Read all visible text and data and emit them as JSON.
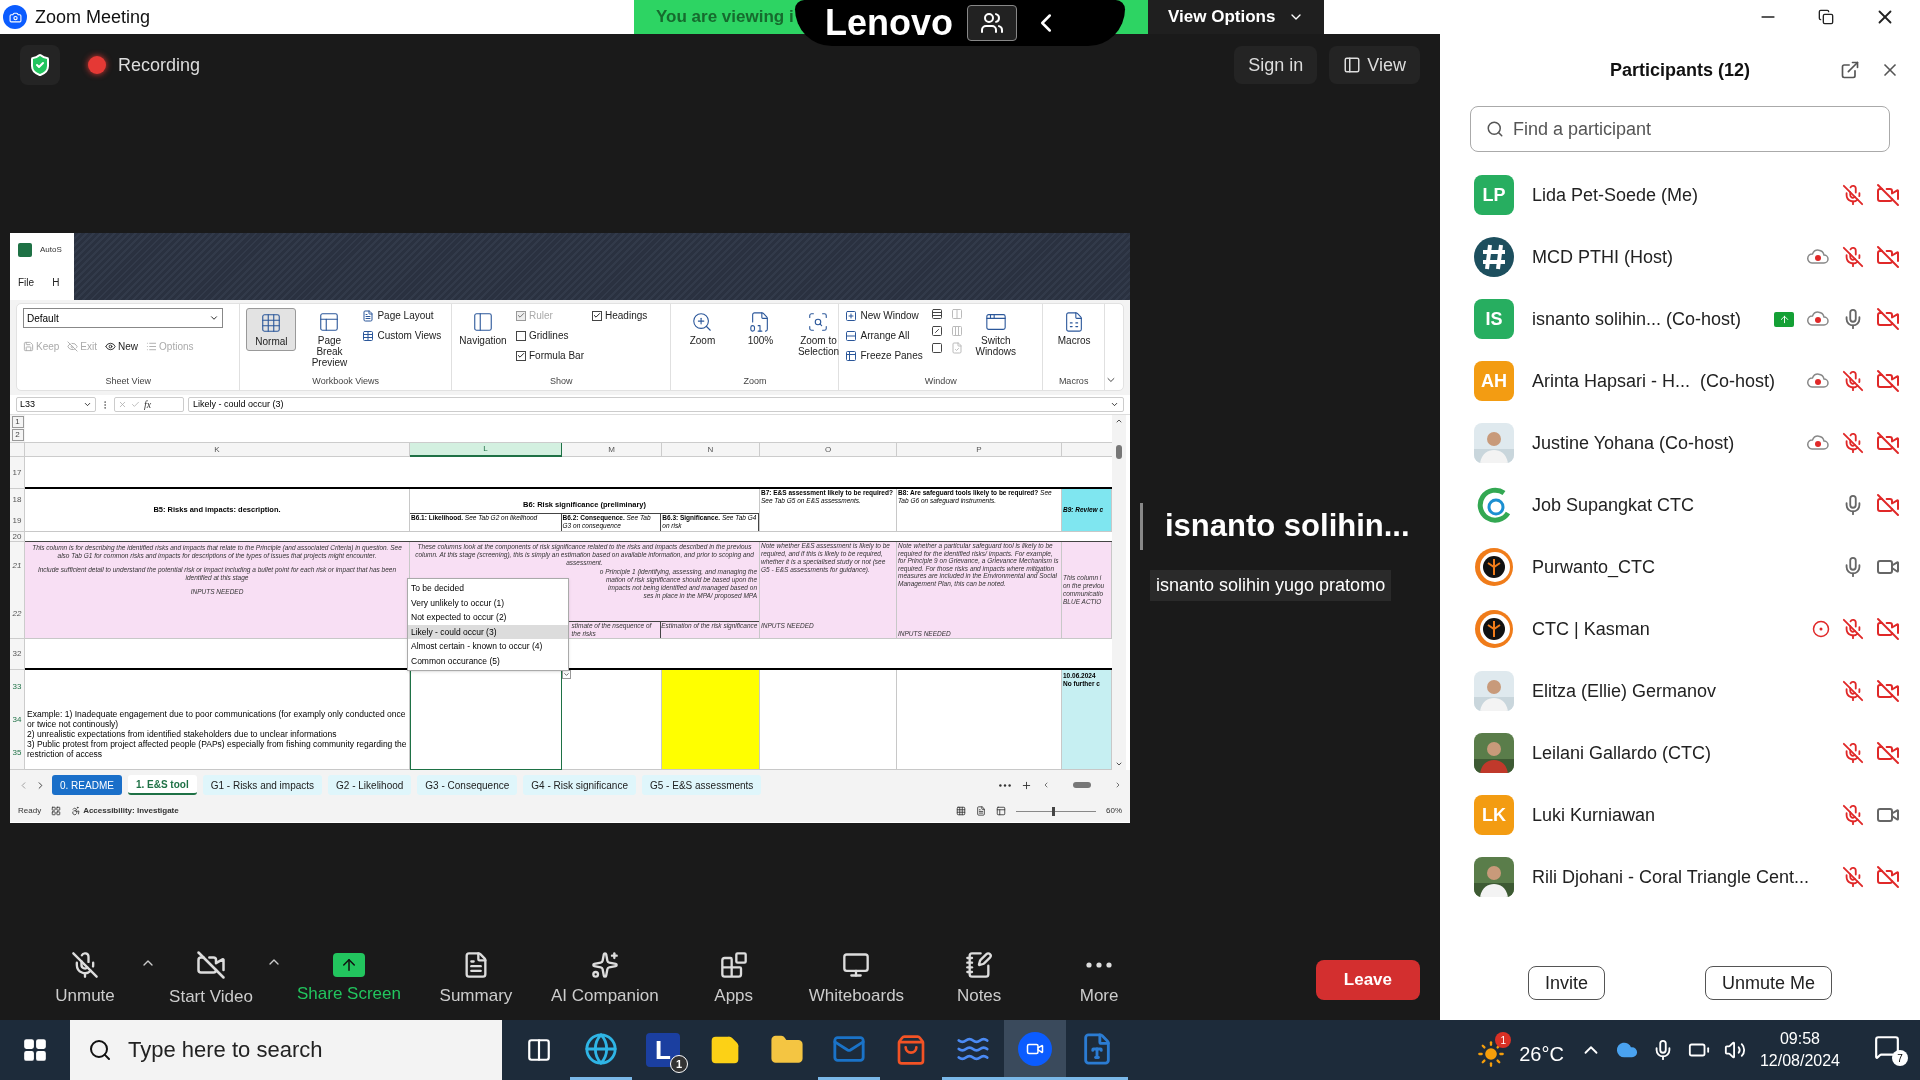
{
  "window": {
    "title": "Zoom Meeting"
  },
  "share_bar": {
    "banner": "You are viewing i",
    "logo": "Lenovo",
    "view_options": "View Options"
  },
  "top_bar": {
    "recording": "Recording",
    "sign_in": "Sign in",
    "view": "View"
  },
  "excel": {
    "app_title": "AutoS",
    "menu": [
      "File",
      "H"
    ],
    "ribbon": [
      {
        "label": "Sheet View",
        "columns": [
          [
            {
              "kind": "select",
              "label": "Default"
            },
            {
              "kind": "row",
              "items": [
                {
                  "label": "Keep",
                  "disabled": true
                },
                {
                  "label": "Exit",
                  "disabled": true
                },
                {
                  "label": "New",
                  "disabled": false
                },
                {
                  "label": "Options",
                  "disabled": true
                }
              ]
            }
          ]
        ]
      },
      {
        "label": "Workbook Views",
        "columns": [
          [
            {
              "kind": "large",
              "label": "Normal",
              "selected": true
            }
          ],
          [
            {
              "kind": "large",
              "label": "Page Break Preview",
              "selected": false
            }
          ],
          [
            {
              "kind": "small",
              "label": "Page Layout"
            },
            {
              "kind": "small",
              "label": "Custom Views"
            }
          ]
        ]
      },
      {
        "label": "Show",
        "columns": [
          [
            {
              "kind": "large",
              "label": "Navigation",
              "selected": false
            }
          ],
          [
            {
              "kind": "check",
              "label": "Ruler",
              "checked": true,
              "disabled": true
            },
            {
              "kind": "check",
              "label": "Gridlines",
              "checked": false,
              "disabled": false
            },
            {
              "kind": "check",
              "label": "Formula Bar",
              "checked": true,
              "disabled": false
            }
          ],
          [
            {
              "kind": "check",
              "label": "Headings",
              "checked": true,
              "disabled": false
            }
          ]
        ]
      },
      {
        "label": "Zoom",
        "columns": [
          [
            {
              "kind": "large",
              "label": "Zoom",
              "selected": false
            }
          ],
          [
            {
              "kind": "large",
              "label": "100%",
              "selected": false
            }
          ],
          [
            {
              "kind": "large",
              "label": "Zoom to Selection",
              "selected": false
            }
          ]
        ]
      },
      {
        "label": "Window",
        "columns": [
          [
            {
              "kind": "small",
              "label": "New Window"
            },
            {
              "kind": "small",
              "label": "Arrange All"
            },
            {
              "kind": "small",
              "label": "Freeze Panes"
            }
          ],
          [
            {
              "kind": "icon",
              "disabled": false
            },
            {
              "kind": "icon",
              "disabled": false
            },
            {
              "kind": "icon",
              "disabled": false
            }
          ],
          [
            {
              "kind": "icon",
              "disabled": true
            },
            {
              "kind": "icon",
              "disabled": true
            },
            {
              "kind": "icon",
              "disabled": true
            }
          ],
          [
            {
              "kind": "large",
              "label": "Switch Windows",
              "selected": false
            }
          ]
        ]
      },
      {
        "label": "Macros",
        "columns": [
          [
            {
              "kind": "large",
              "label": "Macros",
              "selected": false
            }
          ]
        ]
      }
    ],
    "name_box": "L33",
    "fx": "fx",
    "formula": "Likely - could occur (3)",
    "outline_levels": [
      "1",
      "2"
    ],
    "columns": [
      {
        "label": "K",
        "selected": false
      },
      {
        "label": "L",
        "selected": true
      },
      {
        "label": "M",
        "selected": false
      },
      {
        "label": "N",
        "selected": false
      },
      {
        "label": "O",
        "selected": false
      },
      {
        "label": "P",
        "selected": false
      }
    ],
    "row_numbers": [
      [
        "17"
      ],
      [
        "18",
        "19"
      ],
      [
        "20"
      ],
      [
        "21",
        "22"
      ],
      [
        "32"
      ],
      [
        "33",
        "34",
        "35"
      ]
    ],
    "header": {
      "k": "B5: Risks and impacts: description.",
      "b6": "B6: Risk significance (preliminary)",
      "b6_sub": [
        "**B6.1: Likelihood.** *See Tab G2 on likelihood*",
        "**B6.2: Consequence.** *See Tab G3 on consequence*",
        "**B6.3: Significance.** *See Tab G4 on risk*"
      ],
      "o": "**B7: E&S assessment likely to be required?** *See Tab G5 on E&S assessments.*",
      "p": "**B8: Are safeguard tools likely to be required?** *See Tab G6 on safeguard instruments.*",
      "q": "B9: Review c"
    },
    "guidance": {
      "k": [
        "This column is for describing the identified risks and impacts that relate to the Principle (and associated Criteria) in question. See also Tab G1 for common risks and impacts for descriptions of the types of issues that projects might encounter.",
        "Include sufficient detail to understand the potential risk or impact including a bullet point for each risk or impact that has been identified at this stage",
        "INPUTS NEEDED"
      ],
      "lmn": "These columns look at the components of risk significance related to the risks and impacts described in the previous column. At this stage (screening), this is simply an estimation based on available information, and prior to scoping and assessment.",
      "lmn_fragments": [
        "o Principle 1 (identifying, assessing, and managing the",
        "mation of risk significance should be based upon the",
        "impacts not being identified and managed based on",
        "ses in place in the MPA/ proposed MPA"
      ],
      "m_sub": "stimate of the nsequence of the risks",
      "n_sub": "Estimation of the risk significance",
      "o": [
        "Note whether E&S assessment is likely to be required, and if this is likely to be required, whether it is a specialised study or not (see G5 - E&S assessments for guidance).",
        "INPUTS NEEDED"
      ],
      "p": [
        "Note whether a particular safeguard tool is likely to be required for the identified risks/ impacts. For example, for Principle 9 on Grievance, a Grievance Mechanism is required. For those risks and impacts where mitigation measures are included in the Environmental and Social Management Plan, this can be noted.",
        "INPUTS NEEDED"
      ],
      "q": [
        "This column i",
        "on the previou",
        "communicatio",
        "BLUE ACTIO"
      ]
    },
    "example": {
      "k": [
        "Example: 1) Inadequate engagement due to poor communications (for examply only conducted once or twice not continously)",
        "2) unrealistic expectations from identified stakeholders due to unclear informations",
        "3) Public protest from project affected people (PAPs) especially from fishing community regarding the restriction of access"
      ],
      "q": [
        "10.06.2024",
        "No further c"
      ]
    },
    "dropdown": [
      {
        "label": "To be decided",
        "selected": false
      },
      {
        "label": "Very unlikely to occur (1)",
        "selected": false
      },
      {
        "label": "Not expected to occur (2)",
        "selected": false
      },
      {
        "label": "Likely - could occur (3)",
        "selected": true
      },
      {
        "label": "Almost certain - known to occur (4)",
        "selected": false
      },
      {
        "label": "Common occurance (5)",
        "selected": false
      }
    ],
    "tabs": [
      {
        "label": "0. README",
        "selected": false,
        "color": "#1a6fc9"
      },
      {
        "label": "1. E&S tool",
        "selected": true,
        "color": "#ffffff"
      },
      {
        "label": "G1 - Risks and impacts",
        "selected": false,
        "color": "#dff6fb"
      },
      {
        "label": "G2 - Likelihood",
        "selected": false,
        "color": "#dff6fb"
      },
      {
        "label": "G3 - Consequence",
        "selected": false,
        "color": "#dff6fb"
      },
      {
        "label": "G4 - Risk significance",
        "selected": false,
        "color": "#dff6fb"
      },
      {
        "label": "G5 - E&S assessments",
        "selected": false,
        "color": "#dff6fb"
      }
    ],
    "status": {
      "ready": "Ready",
      "accessibility": "Accessibility: Investigate",
      "level": 0.45,
      "zoom": "60%"
    }
  },
  "speaker": {
    "name": "isnanto solihin...",
    "full_name": "isnanto solihin yugo pratomo"
  },
  "participants": {
    "title": "Participants (12)",
    "search_placeholder": "Find a participant",
    "items": [
      {
        "name": "Lida Pet-Soede (Me)",
        "kind": "initials",
        "initials": "LP",
        "color": "#27ae60",
        "cloud_recording": false,
        "local_recording": false,
        "muted": true,
        "video": false,
        "sharing": false
      },
      {
        "name": "MCD PTHI (Host)",
        "kind": "hash",
        "cloud_recording": true,
        "local_recording": false,
        "muted": true,
        "video": false,
        "sharing": false
      },
      {
        "name": "isnanto solihin... (Co-host)",
        "kind": "initials",
        "initials": "IS",
        "color": "#27ae60",
        "cloud_recording": true,
        "local_recording": false,
        "muted": false,
        "video": false,
        "sharing": true
      },
      {
        "name": "Arinta Hapsari - H...  (Co-host)",
        "kind": "initials",
        "initials": "AH",
        "color": "#f39c12",
        "cloud_recording": true,
        "local_recording": false,
        "muted": true,
        "video": false,
        "sharing": false
      },
      {
        "name": "Justine Yohana (Co-host)",
        "cloud_recording": true,
        "local_recording": false,
        "muted": true,
        "video": false,
        "sharing": false
      },
      {
        "name": "Job Supangkat CTC",
        "kind": "arc",
        "cloud_recording": false,
        "local_recording": false,
        "muted": false,
        "video": false,
        "sharing": false
      },
      {
        "name": "Purwanto_CTC",
        "kind": "ring",
        "cloud_recording": false,
        "local_recording": false,
        "muted": false,
        "video": true,
        "sharing": false
      },
      {
        "name": "CTC | Kasman",
        "kind": "ring",
        "cloud_recording": false,
        "local_recording": true,
        "muted": true,
        "video": false,
        "sharing": false
      },
      {
        "name": "Elitza (Ellie) Germanov",
        "cloud_recording": false,
        "local_recording": false,
        "muted": true,
        "video": false,
        "sharing": false
      },
      {
        "name": "Leilani Gallardo (CTC)",
        "cloud_recording": false,
        "local_recording": false,
        "muted": true,
        "video": false,
        "sharing": false
      },
      {
        "name": "Luki Kurniawan",
        "kind": "initials",
        "initials": "LK",
        "color": "#f39c12",
        "cloud_recording": false,
        "local_recording": false,
        "muted": true,
        "video": true,
        "sharing": false
      },
      {
        "name": "Rili Djohani - Coral Triangle Cent...",
        "cloud_recording": false,
        "local_recording": false,
        "muted": true,
        "video": false,
        "sharing": false
      }
    ],
    "buttons": [
      "Invite",
      "Unmute Me"
    ]
  },
  "toolbar": [
    {
      "kind": "audio",
      "label": "Unmute",
      "muted": true,
      "has_menu": true
    },
    {
      "kind": "video",
      "label": "Start Video",
      "on": false,
      "has_menu": true
    },
    {
      "kind": "share",
      "label": "Share Screen"
    },
    {
      "kind": "summary",
      "label": "Summary"
    },
    {
      "kind": "ai",
      "label": "AI Companion"
    },
    {
      "kind": "apps",
      "label": "Apps"
    },
    {
      "kind": "whiteboards",
      "label": "Whiteboards"
    },
    {
      "kind": "notes",
      "label": "Notes"
    },
    {
      "kind": "more",
      "label": "More"
    }
  ],
  "leave": "Leave",
  "taskbar": {
    "search_placeholder": "Type here to search",
    "apps": [
      {
        "kind": "task-view",
        "running": false,
        "selected": false
      },
      {
        "kind": "edge",
        "running": true,
        "selected": false
      },
      {
        "kind": "letter",
        "label": "L",
        "badge": "1",
        "running": false,
        "selected": false
      },
      {
        "kind": "sticky",
        "running": false,
        "selected": false
      },
      {
        "kind": "explorer",
        "running": false,
        "selected": false
      },
      {
        "kind": "outlook",
        "running": true,
        "selected": false
      },
      {
        "kind": "store",
        "running": false,
        "selected": false
      },
      {
        "kind": "wave",
        "running": true,
        "selected": false
      },
      {
        "kind": "zoom",
        "running": true,
        "selected": true
      },
      {
        "kind": "word",
        "running": true,
        "selected": false
      }
    ],
    "weather_badge": "1",
    "temperature": "26°C",
    "time": "09:58",
    "date": "12/08/2024",
    "notifications": "7"
  }
}
